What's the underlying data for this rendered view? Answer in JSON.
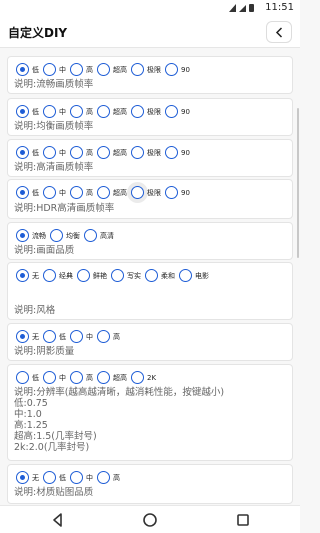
{
  "status": {
    "time": "11:51"
  },
  "app": {
    "title": "自定义DIY"
  },
  "sections": [
    {
      "options": [
        "低",
        "中",
        "高",
        "超高",
        "极限",
        "90"
      ],
      "selected": 0,
      "desc": "说明:流畅画质帧率"
    },
    {
      "options": [
        "低",
        "中",
        "高",
        "超高",
        "极限",
        "90"
      ],
      "selected": 0,
      "desc": "说明:均衡画质帧率"
    },
    {
      "options": [
        "低",
        "中",
        "高",
        "超高",
        "极限",
        "90"
      ],
      "selected": 0,
      "desc": "说明:高清画质帧率"
    },
    {
      "options": [
        "低",
        "中",
        "高",
        "超高",
        "极限",
        "90"
      ],
      "selected": 0,
      "desc": "说明:HDR高清画质帧率"
    },
    {
      "options": [
        "流畅",
        "均衡",
        "高清"
      ],
      "selected": 0,
      "desc": "说明:画面品质"
    },
    {
      "options": [
        "无",
        "经典",
        "鲜艳",
        "写实",
        "柔和",
        "电影"
      ],
      "selected": 0,
      "desc": "说明:风格"
    },
    {
      "options": [
        "无",
        "低",
        "中",
        "高"
      ],
      "selected": 0,
      "desc": "说明:阴影质量"
    },
    {
      "options": [
        "低",
        "中",
        "高",
        "超高",
        "2K"
      ],
      "selected": -1,
      "desc": "说明:分辨率(越高越清晰，越消耗性能，按键越小)",
      "lines": [
        "低:0.75",
        "中:1.0",
        "高:1.25",
        "超高:1.5(几率封号)",
        "2k:2.0(几率封号)"
      ]
    },
    {
      "options": [
        "无",
        "低",
        "中",
        "高"
      ],
      "selected": 0,
      "desc": "说明:材质贴图品质"
    }
  ],
  "icons": {
    "back": "chevron-left-icon",
    "nav_back": "triangle-back-icon",
    "nav_home": "circle-home-icon",
    "nav_recent": "square-recent-icon"
  },
  "colors": {
    "accent": "#1e5dd6"
  }
}
